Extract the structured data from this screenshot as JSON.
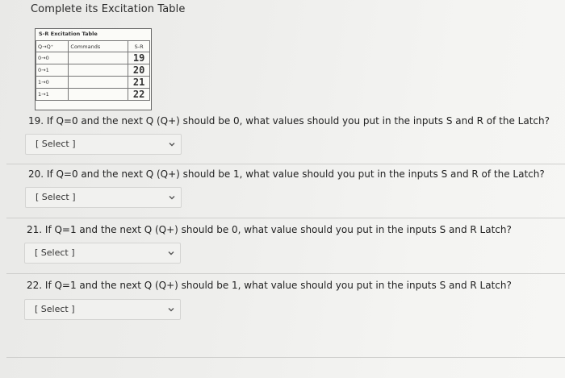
{
  "heading": "Complete its Excitation Table",
  "table": {
    "title": "S-R Excitation Table",
    "headers": [
      "Q→Q⁺",
      "Commands",
      "S-R"
    ],
    "rows": [
      {
        "trans": "0→0",
        "cmd": "",
        "answer": "19"
      },
      {
        "trans": "0→1",
        "cmd": "",
        "answer": "20"
      },
      {
        "trans": "1→0",
        "cmd": "",
        "answer": "21"
      },
      {
        "trans": "1→1",
        "cmd": "",
        "answer": "22"
      }
    ]
  },
  "questions": [
    {
      "text": "19. If Q=0 and the next Q (Q+) should be 0, what values should you put in the inputs S and R of the Latch?",
      "select": "[ Select ]"
    },
    {
      "text": "20. If Q=0 and the next Q (Q+) should be 1, what value should you put in the inputs S and R of the Latch?",
      "select": "[ Select ]"
    },
    {
      "text": "21. If Q=1 and the next Q (Q+) should be 0, what value should you put in the inputs S and R Latch?",
      "select": "[ Select ]"
    },
    {
      "text": "22. If Q=1 and the next Q (Q+) should be 1, what value should you put in the inputs S and R Latch?",
      "select": "[ Select ]"
    }
  ],
  "icons": {
    "dropdown": "chevron-down-icon"
  }
}
